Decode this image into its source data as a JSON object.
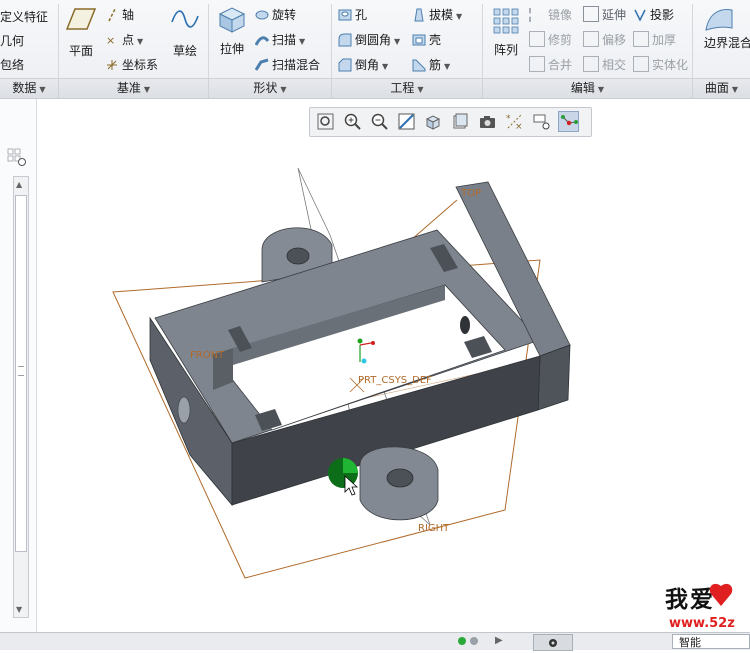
{
  "ribbon": {
    "data_group": {
      "items": [
        "定义特征",
        "几何",
        "包络"
      ],
      "label": "数据"
    },
    "datum_group": {
      "plane_label": "平面",
      "axis_label": "轴",
      "point_label": "点",
      "csys_label": "坐标系",
      "sketch_label": "草绘",
      "label": "基准"
    },
    "shapes_group": {
      "extrude_label": "拉伸",
      "revolve_label": "旋转",
      "sweep_label": "扫描",
      "swept_blend_label": "扫描混合",
      "label": "形状"
    },
    "engineering_group": {
      "hole_label": "孔",
      "round_label": "倒圆角",
      "chamfer_label": "倒角",
      "draft_label": "拔模",
      "shell_label": "壳",
      "rib_label": "筋",
      "label": "工程"
    },
    "editing_group": {
      "pattern_label": "阵列",
      "mirror_label": "镜像",
      "trim_label": "修剪",
      "merge_label": "合并",
      "extend_label": "延伸",
      "offset_label": "偏移",
      "intersect_label": "相交",
      "project_label": "投影",
      "thicken_label": "加厚",
      "solidify_label": "实体化",
      "label": "编辑"
    },
    "surfaces_group": {
      "boundary_blend_label": "边界混合",
      "label": "曲面"
    }
  },
  "viewport": {
    "datum_labels": {
      "top": "TOP",
      "front": "FRONT",
      "right": "RIGHT",
      "csys": "PRT_CSYS_DEF"
    }
  },
  "watermark": {
    "chars": "我爱",
    "url": "www.52z"
  },
  "statusbar": {
    "filter_value": "智能"
  },
  "colors": {
    "datum_plane": "#b06a2a",
    "model_face": "#7d838c",
    "model_top": "#6e747d",
    "model_dark": "#4f545b",
    "csys_green": "#1fa21f"
  }
}
